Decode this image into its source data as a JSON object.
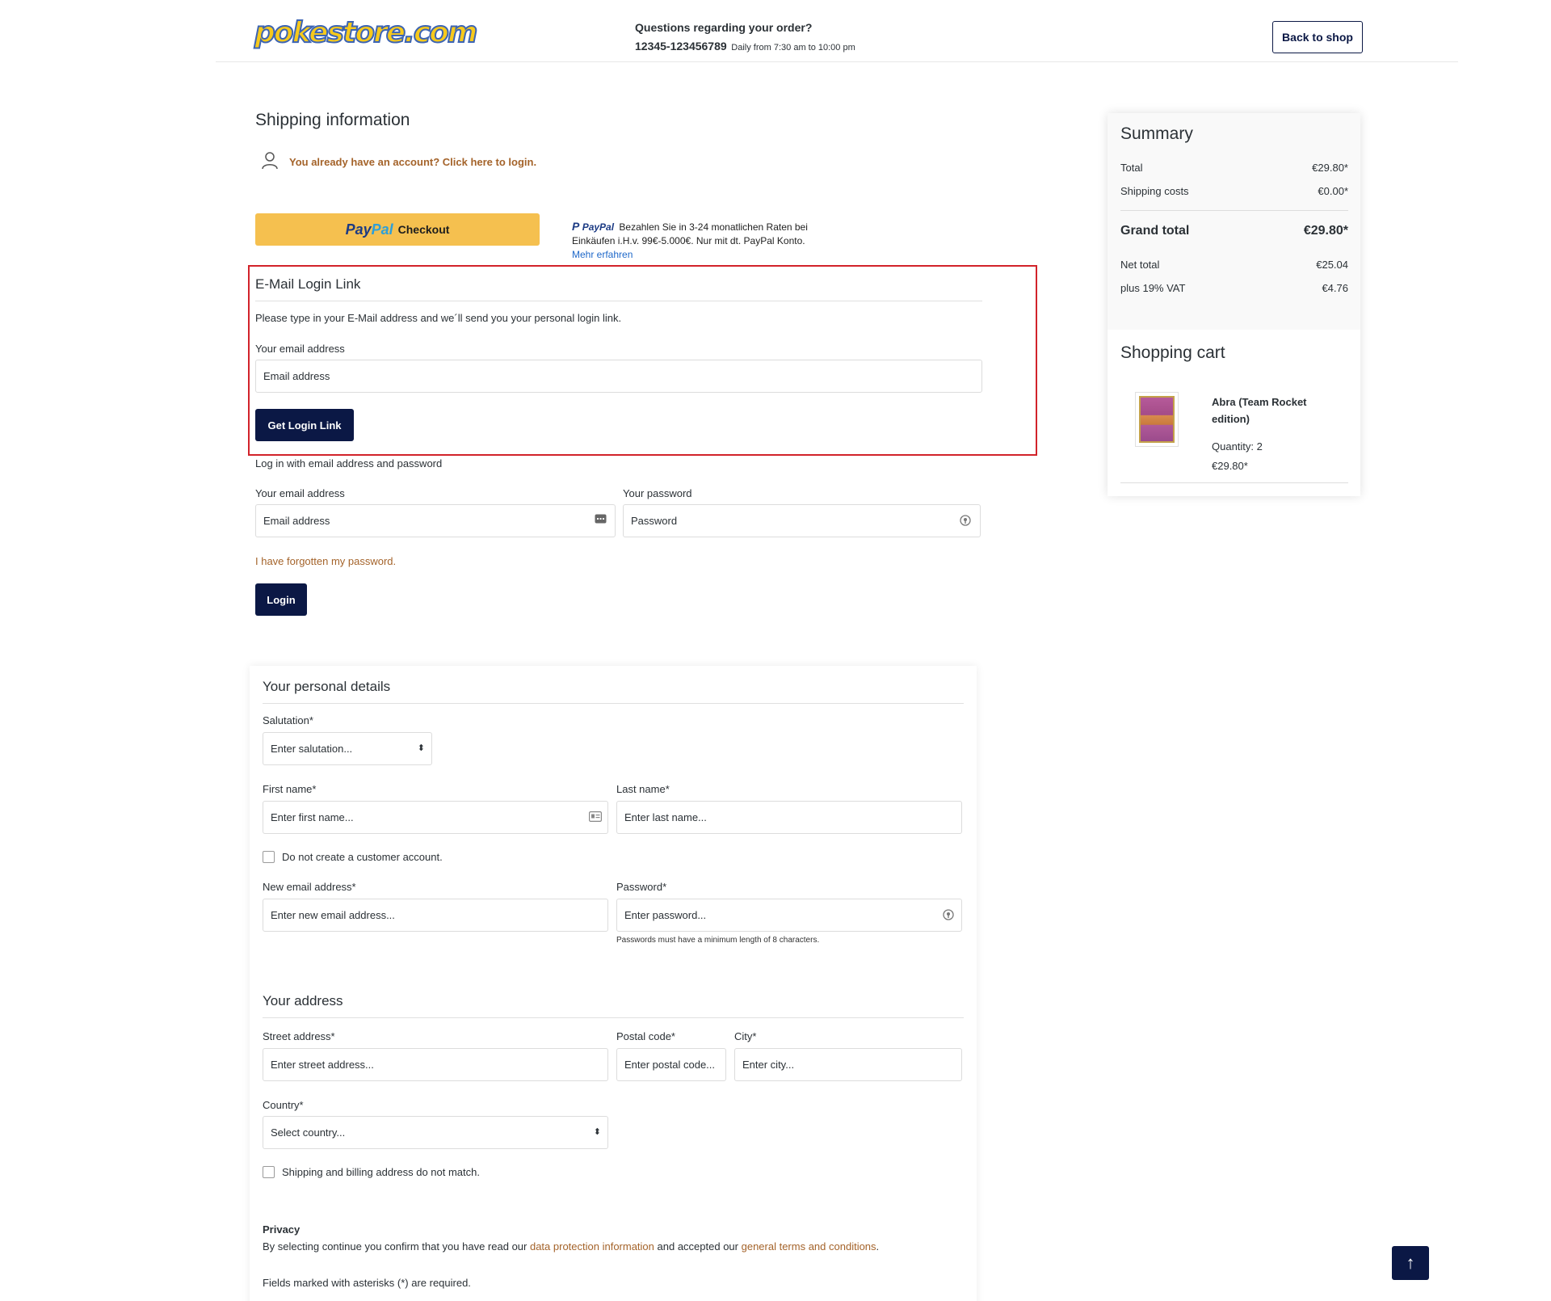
{
  "header": {
    "logo_text": "pokestore.com",
    "question": "Questions regarding your order?",
    "phone": "12345-123456789",
    "hours": "Daily from 7:30 am to 10:00 pm",
    "back_to_shop": "Back to shop"
  },
  "shipping": {
    "title": "Shipping information",
    "account_link": "You already have an account? Click here to login.",
    "paypal_checkout": {
      "pay": "Pay",
      "pal": "Pal",
      "label": "Checkout"
    },
    "paypal_info": {
      "logo": "PayPal",
      "text": "Bezahlen Sie in 3-24 monatlichen Raten bei Einkäufen i.H.v. 99€-5.000€. Nur mit dt. PayPal Konto.",
      "more": "Mehr erfahren"
    }
  },
  "email_login": {
    "title": "E-Mail Login Link",
    "description": "Please type in your E-Mail address and we´ll send you your personal login link.",
    "email_label": "Your email address",
    "email_placeholder": "Email address",
    "button": "Get Login Link"
  },
  "password_login": {
    "title": "Log in with email address and password",
    "email_label": "Your email address",
    "email_placeholder": "Email address",
    "password_label": "Your password",
    "password_placeholder": "Password",
    "forgot": "I have forgotten my password.",
    "button": "Login"
  },
  "personal": {
    "title": "Your personal details",
    "salutation_label": "Salutation*",
    "salutation_value": "Enter salutation...",
    "first_name_label": "First name*",
    "first_name_placeholder": "Enter first name...",
    "last_name_label": "Last name*",
    "last_name_placeholder": "Enter last name...",
    "no_account": "Do not create a customer account.",
    "email_label": "New email address*",
    "email_placeholder": "Enter new email address...",
    "password_label": "Password*",
    "password_placeholder": "Enter password...",
    "password_hint": "Passwords must have a minimum length of 8 characters."
  },
  "address": {
    "title": "Your address",
    "street_label": "Street address*",
    "street_placeholder": "Enter street address...",
    "postal_label": "Postal code*",
    "postal_placeholder": "Enter postal code...",
    "city_label": "City*",
    "city_placeholder": "Enter city...",
    "country_label": "Country*",
    "country_value": "Select country...",
    "different_billing": "Shipping and billing address do not match."
  },
  "privacy": {
    "title": "Privacy",
    "text_before": "By selecting continue you confirm that you have read our ",
    "link1": "data protection information",
    "text_middle": " and accepted our ",
    "link2": "general terms and conditions",
    "text_after": ".",
    "required_note": "Fields marked with asterisks (*) are required."
  },
  "summary": {
    "title": "Summary",
    "total_label": "Total",
    "total_value": "€29.80*",
    "shipping_label": "Shipping costs",
    "shipping_value": "€0.00*",
    "grand_label": "Grand total",
    "grand_value": "€29.80*",
    "net_label": "Net total",
    "net_value": "€25.04",
    "vat_label": "plus 19% VAT",
    "vat_value": "€4.76"
  },
  "cart": {
    "title": "Shopping cart",
    "items": [
      {
        "name": "Abra (Team Rocket edition)",
        "quantity": "Quantity: 2",
        "price": "€29.80*"
      }
    ]
  }
}
